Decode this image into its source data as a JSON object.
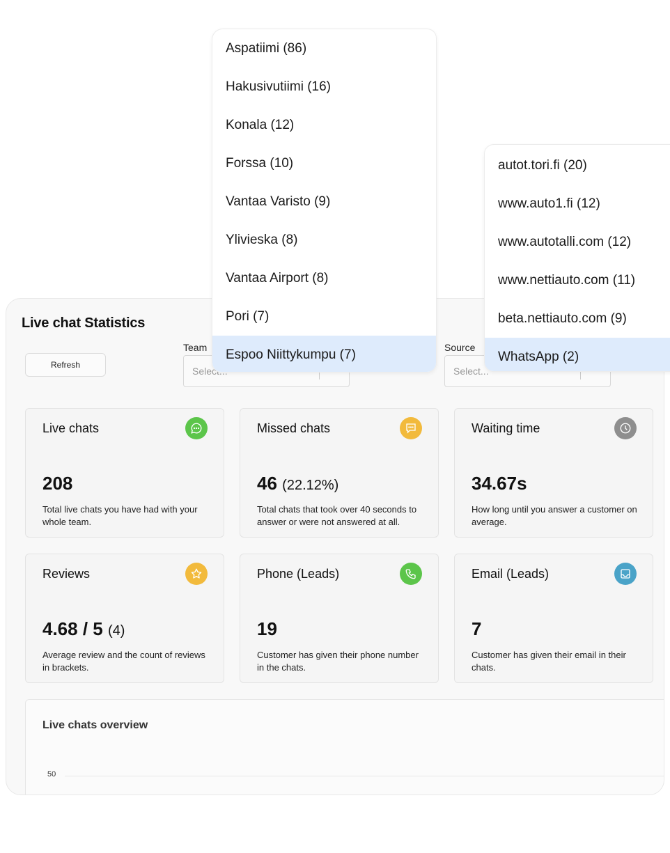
{
  "header": {
    "title": "Live chat Statistics"
  },
  "toolbar": {
    "refresh_label": "Refresh",
    "team": {
      "label": "Team",
      "placeholder": "Select..."
    },
    "source": {
      "label": "Source",
      "placeholder": "Select..."
    }
  },
  "cards": [
    {
      "title": "Live chats",
      "value": "208",
      "sub": "",
      "desc": "Total live chats you have had with your whole team.",
      "icon": "chat-bubble-icon",
      "color": "#5cc54a"
    },
    {
      "title": "Missed chats",
      "value": "46",
      "sub": "(22.12%)",
      "desc": "Total chats that took over 40 seconds to answer or were not answered at all.",
      "icon": "message-square-icon",
      "color": "#f2ba3c"
    },
    {
      "title": "Waiting time",
      "value": "34.67s",
      "sub": "",
      "desc": "How long until you answer a customer on average.",
      "icon": "clock-icon",
      "color": "#8e8e8e"
    },
    {
      "title": "Reviews",
      "value": "4.68 / 5",
      "sub": "(4)",
      "desc": "Average review and the count of reviews in brackets.",
      "icon": "star-icon",
      "color": "#f2ba3c"
    },
    {
      "title": "Phone (Leads)",
      "value": "19",
      "sub": "",
      "desc": "Customer has given their phone number in the chats.",
      "icon": "phone-icon",
      "color": "#5cc54a"
    },
    {
      "title": "Email (Leads)",
      "value": "7",
      "sub": "",
      "desc": "Customer has given their email in their chats.",
      "icon": "inbox-icon",
      "color": "#4aa3c8"
    }
  ],
  "overview": {
    "title": "Live chats overview",
    "y_ticks": [
      "50"
    ]
  },
  "team_dropdown": {
    "items": [
      {
        "label": "Aspatiimi (86)"
      },
      {
        "label": "Hakusivutiimi (16)"
      },
      {
        "label": "Konala (12)"
      },
      {
        "label": "Forssa (10)"
      },
      {
        "label": "Vantaa Varisto (9)"
      },
      {
        "label": "Ylivieska (8)"
      },
      {
        "label": "Vantaa Airport (8)"
      },
      {
        "label": "Pori (7)"
      },
      {
        "label": "Espoo Niittykumpu (7)"
      }
    ],
    "highlighted_index": 8
  },
  "source_dropdown": {
    "items": [
      {
        "label": "autot.tori.fi (20)"
      },
      {
        "label": "www.auto1.fi (12)"
      },
      {
        "label": "www.autotalli.com (12)"
      },
      {
        "label": "www.nettiauto.com (11)"
      },
      {
        "label": "beta.nettiauto.com (9)"
      },
      {
        "label": "WhatsApp (2)"
      }
    ],
    "highlighted_index": 5
  }
}
